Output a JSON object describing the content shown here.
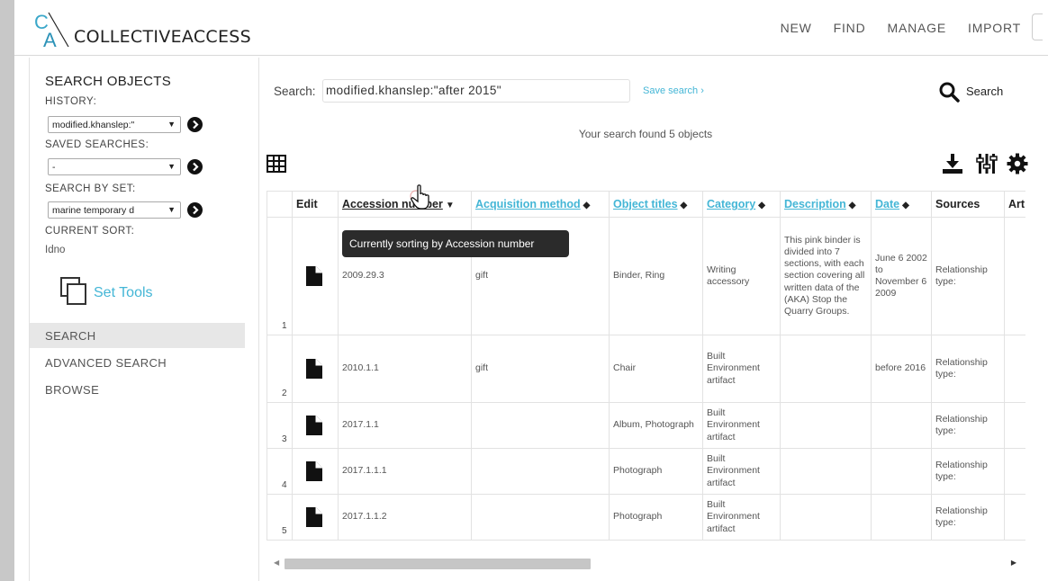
{
  "header": {
    "logo_text": "COLLECTIVEACCESS",
    "nav": [
      "NEW",
      "FIND",
      "MANAGE",
      "IMPORT"
    ]
  },
  "sidebar": {
    "title": "SEARCH OBJECTS",
    "history_label": "HISTORY:",
    "history_value": "modified.khanslep:\"",
    "saved_label": "SAVED SEARCHES:",
    "saved_value": "-",
    "by_set_label": "SEARCH BY SET:",
    "by_set_value": "marine temporary d",
    "sort_label": "CURRENT SORT:",
    "sort_value": "Idno",
    "set_tools": "Set Tools",
    "nav": [
      "SEARCH",
      "ADVANCED SEARCH",
      "BROWSE"
    ],
    "active_nav": "SEARCH"
  },
  "search": {
    "label": "Search:",
    "value": "modified.khanslep:\"after 2015\"",
    "save_link": "Save search ›",
    "button": "Search",
    "result_text": "Your search found 5 objects"
  },
  "tooltip": "Currently sorting by Accession number",
  "table": {
    "columns": [
      "Edit",
      "Accession number",
      "Acquisition method",
      "Object titles",
      "Category",
      "Description",
      "Date",
      "Sources",
      "Art"
    ],
    "rows": [
      {
        "num": "1",
        "accession": "2009.29.3",
        "acquisition": "gift",
        "titles": "Binder, Ring",
        "category": "Writing accessory",
        "description": "This pink binder is divided into 7 sections, with each section covering all written data of the (AKA) Stop the Quarry Groups.",
        "date": "June 6 2002 to November 6 2009",
        "sources": "Relationship type:"
      },
      {
        "num": "2",
        "accession": "2010.1.1",
        "acquisition": "gift",
        "titles": "Chair",
        "category": "Built Environment artifact",
        "description": "",
        "date": "before 2016",
        "sources": "Relationship type:"
      },
      {
        "num": "3",
        "accession": "2017.1.1",
        "acquisition": "",
        "titles": "Album, Photograph",
        "category": "Built Environment artifact",
        "description": "",
        "date": "",
        "sources": "Relationship type:"
      },
      {
        "num": "4",
        "accession": "2017.1.1.1",
        "acquisition": "",
        "titles": "Photograph",
        "category": "Built Environment artifact",
        "description": "",
        "date": "",
        "sources": "Relationship type:"
      },
      {
        "num": "5",
        "accession": "2017.1.1.2",
        "acquisition": "",
        "titles": "Photograph",
        "category": "Built Environment artifact",
        "description": "",
        "date": "",
        "sources": "Relationship type:"
      }
    ]
  },
  "colors": {
    "accent": "#44b6d6",
    "logo_c": "#3aa7c9",
    "logo_a": "#2d93b8"
  },
  "icons": [
    "ca-logo-icon",
    "set-tools-icon",
    "search-icon",
    "grid-view-icon",
    "download-icon",
    "column-settings-icon",
    "gear-icon",
    "document-icon",
    "hand-cursor-icon"
  ]
}
